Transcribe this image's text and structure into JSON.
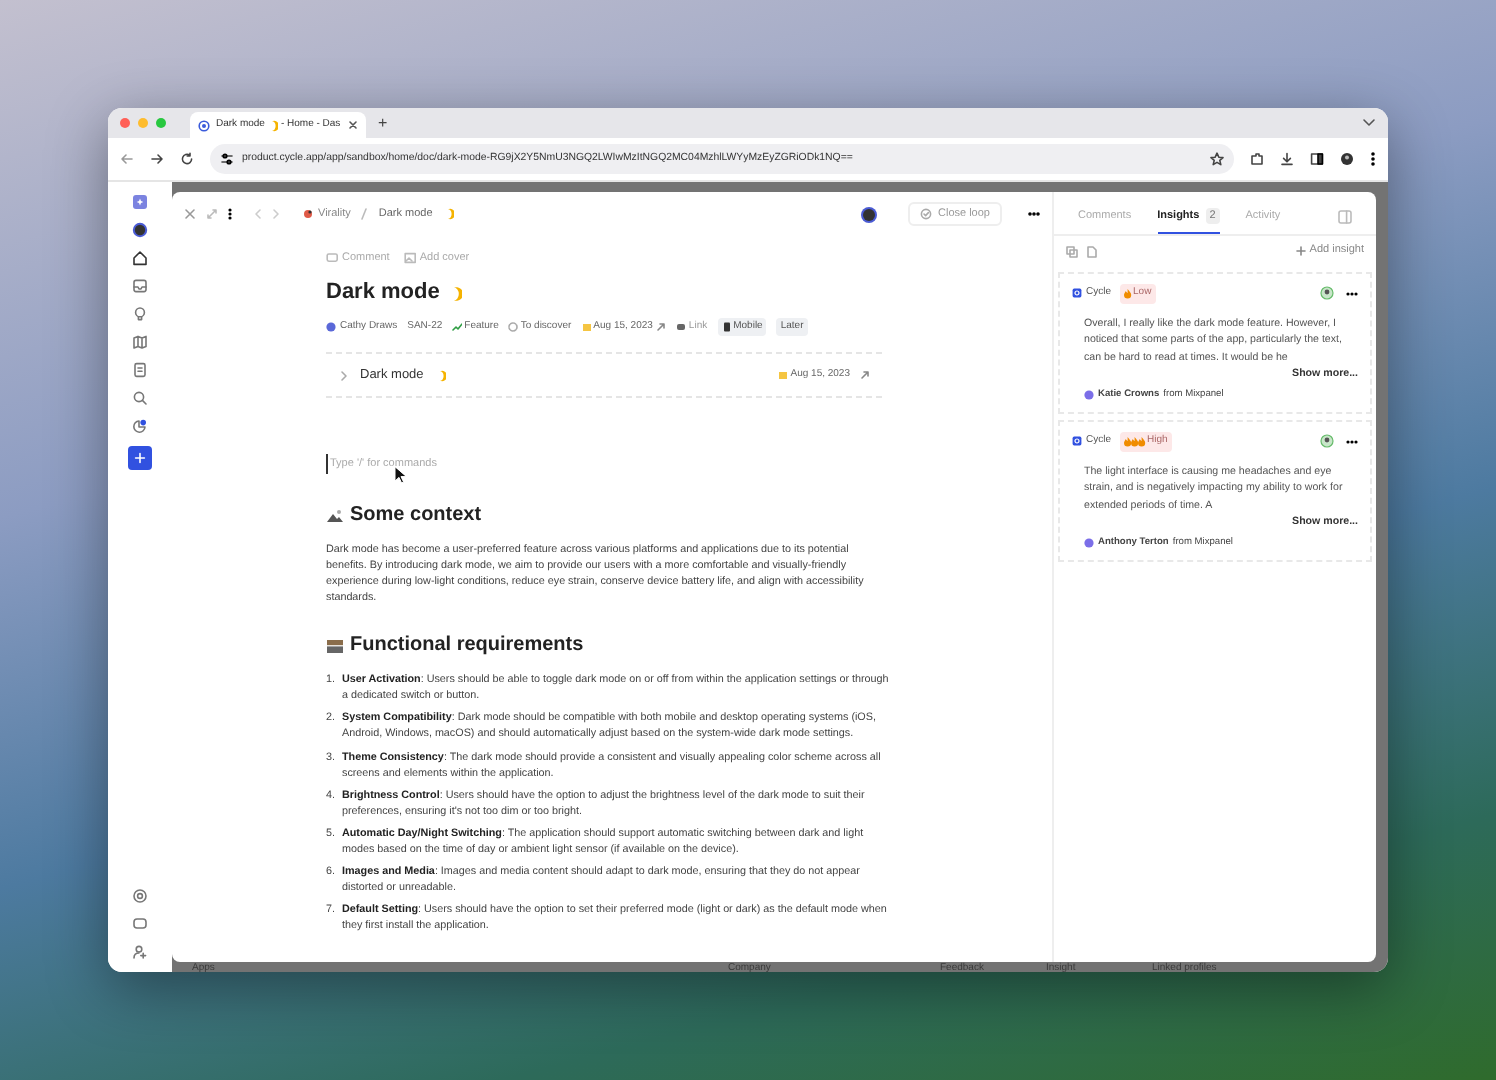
{
  "browser": {
    "tab_title": "Dark mode",
    "tab_suffix": "- Home - Das",
    "new_tab": "+",
    "url": "product.cycle.app/app/sandbox/home/doc/dark-mode-RG9jX2Y5NmU3NGQ2LWIwMzItNGQ2MC04MzhlLWYyMzEyZGRiODk1NQ=="
  },
  "doc": {
    "breadcrumb": [
      "Virality",
      "Dark mode"
    ],
    "close_loop": "Close loop",
    "actions": [
      "Comment",
      "Add cover"
    ],
    "title": "Dark mode",
    "properties": {
      "assignee": "Cathy Draws",
      "id": "SAN-22",
      "type": "Feature",
      "status": "To discover",
      "date": "Aug 15, 2023",
      "link": "Link",
      "tags": [
        "Mobile",
        "Later"
      ]
    },
    "child": {
      "title": "Dark mode",
      "date": "Aug 15, 2023",
      "expanded": false
    },
    "placeholder": "Type '/' for commands",
    "sections": [
      {
        "kind": "paragraph",
        "heading": "Some context",
        "text": "Dark mode has become a user-preferred feature across various platforms and applications due to its potential benefits. By introducing dark mode, we aim to provide our users with a more comfortable and visually-friendly experience during low-light conditions, reduce eye strain, conserve device battery life, and align with accessibility standards."
      },
      {
        "kind": "list",
        "heading": "Functional requirements",
        "items": [
          {
            "number": "1.",
            "text": "**User Activation**: Users should be able to toggle dark mode on or off from within the application settings or through a dedicated switch or button."
          },
          {
            "number": "2.",
            "text": "**System Compatibility**: Dark mode should be compatible with both mobile and desktop operating systems (iOS, Android, Windows, macOS) and should automatically adjust based on the system-wide dark mode settings."
          },
          {
            "number": "3.",
            "text": "**Theme Consistency**: The dark mode should provide a consistent and visually appealing color scheme across all screens and elements within the application."
          },
          {
            "number": "4.",
            "text": "**Brightness Control**: Users should have the option to adjust the brightness level of the dark mode to suit their preferences, ensuring it's not too dim or too bright."
          },
          {
            "number": "5.",
            "text": "**Automatic Day/Night Switching**: The application should support automatic switching between dark and light modes based on the time of day or ambient light sensor (if available on the device)."
          },
          {
            "number": "6.",
            "text": "**Images and Media**: Images and media content should adapt to dark mode, ensuring that they do not appear distorted or unreadable."
          },
          {
            "number": "7.",
            "text": "**Default Setting**: Users should have the option to set their preferred mode (light or dark) as the default mode when they first install the application."
          }
        ]
      }
    ]
  },
  "panel": {
    "tabs": [
      {
        "label": "Comments",
        "selected": false
      },
      {
        "label": "Insights",
        "count": "2",
        "selected": true
      },
      {
        "label": "Activity",
        "selected": false
      }
    ],
    "add_insight": "Add insight",
    "insights": [
      {
        "source": "Cycle",
        "kind": "low",
        "priority_label": "Low",
        "text": "Overall, I really like the dark mode feature. However, I noticed that some parts of the app, particularly the text, can be hard to read at times. It would be he",
        "show_more": "Show more...",
        "author": "Katie Crowns",
        "from": "from Mixpanel"
      },
      {
        "source": "Cycle",
        "kind": "high",
        "priority_label": "High",
        "text": "The light interface is causing me headaches and eye strain, and is negatively impacting my ability to work for extended periods of time. A",
        "show_more": "Show more...",
        "author": "Anthony Terton",
        "from": "from Mixpanel"
      }
    ]
  },
  "background_columns": [
    "Apps",
    "Company",
    "Feedback",
    "Insight",
    "Linked profiles"
  ]
}
